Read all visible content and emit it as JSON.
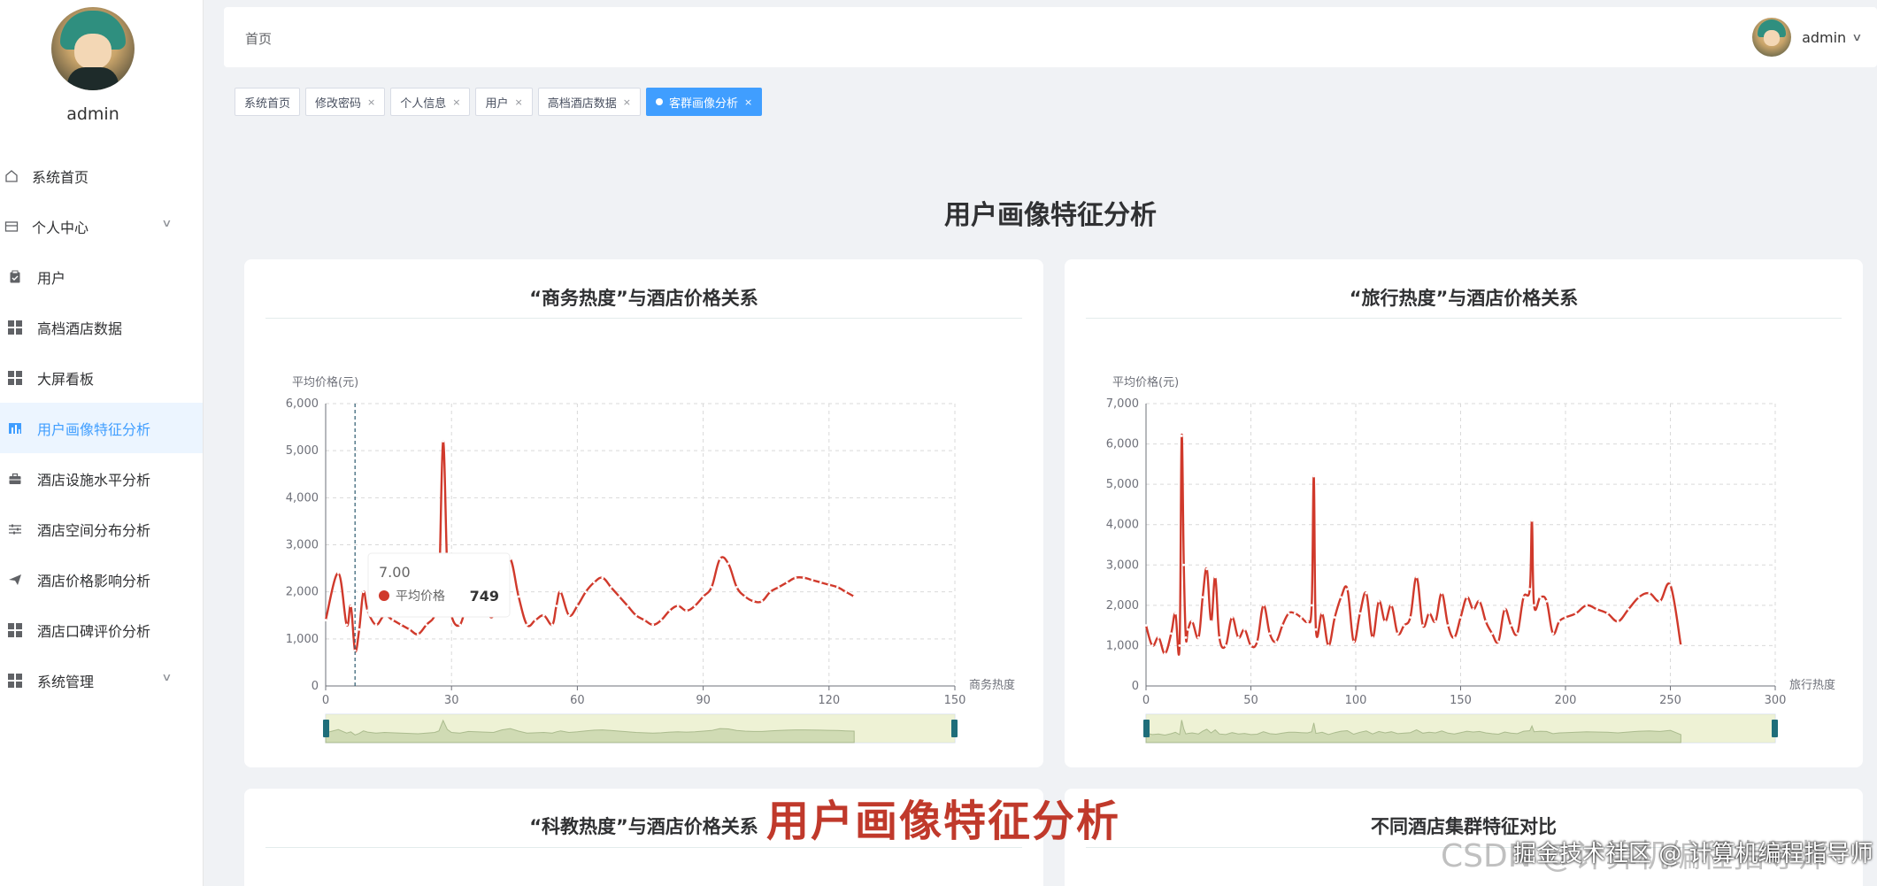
{
  "sidebar": {
    "username": "admin",
    "items": [
      {
        "label": "系统首页",
        "icon": "home-icon"
      },
      {
        "label": "个人中心",
        "icon": "id-card-icon",
        "expandable": true
      },
      {
        "label": "用户",
        "icon": "clipboard-icon"
      },
      {
        "label": "高档酒店数据",
        "icon": "grid-icon"
      },
      {
        "label": "大屏看板",
        "icon": "grid-icon"
      },
      {
        "label": "用户画像特征分析",
        "icon": "bar-chart-icon",
        "active": true
      },
      {
        "label": "酒店设施水平分析",
        "icon": "briefcase-icon"
      },
      {
        "label": "酒店空间分布分析",
        "icon": "sliders-icon"
      },
      {
        "label": "酒店价格影响分析",
        "icon": "send-icon"
      },
      {
        "label": "酒店口碑评价分析",
        "icon": "grid-icon"
      },
      {
        "label": "系统管理",
        "icon": "grid-icon",
        "expandable": true
      }
    ]
  },
  "header": {
    "breadcrumb": "首页",
    "user": "admin"
  },
  "tags": [
    {
      "label": "系统首页",
      "closable": false
    },
    {
      "label": "修改密码",
      "closable": true
    },
    {
      "label": "个人信息",
      "closable": true
    },
    {
      "label": "用户",
      "closable": true
    },
    {
      "label": "高档酒店数据",
      "closable": true
    },
    {
      "label": "客群画像分析",
      "closable": true,
      "active": true
    }
  ],
  "page_title": "用户画像特征分析",
  "cards": {
    "c1_title": "“商务热度”与酒店价格关系",
    "c2_title": "“旅行热度”与酒店价格关系",
    "c3_title": "“科教热度”与酒店价格关系",
    "c4_title": "不同酒店集群特征对比"
  },
  "overlay_title": "用户画像特征分析",
  "watermark": "CSDN @计算机编程指导师",
  "watermark2": "掘金技术社区 @ 计算机编程指导师",
  "chart_data": [
    {
      "type": "line",
      "title": "“商务热度”与酒店价格关系",
      "xlabel": "商务热度",
      "ylabel": "平均价格(元)",
      "xlim": [
        0,
        150
      ],
      "ylim": [
        0,
        6000
      ],
      "xticks": [
        0,
        30,
        60,
        90,
        120,
        150
      ],
      "yticks": [
        0,
        1000,
        2000,
        3000,
        4000,
        5000,
        6000
      ],
      "grid": true,
      "smooth": true,
      "color": "#d0392b",
      "series": [
        {
          "name": "平均价格",
          "x": [
            0,
            3,
            5,
            6,
            7,
            8,
            9,
            10,
            12,
            14,
            16,
            18,
            20,
            22,
            24,
            26,
            27,
            28,
            29,
            30,
            32,
            34,
            36,
            38,
            40,
            42,
            44,
            46,
            48,
            50,
            52,
            54,
            55,
            56,
            58,
            60,
            62,
            64,
            66,
            68,
            70,
            72,
            74,
            76,
            78,
            80,
            82,
            84,
            86,
            88,
            90,
            92,
            94,
            96,
            98,
            100,
            102,
            104,
            106,
            108,
            110,
            112,
            114,
            116,
            118,
            120,
            122,
            124,
            126
          ],
          "y": [
            1400,
            2400,
            1300,
            1700,
            749,
            1200,
            2000,
            1600,
            1300,
            1500,
            1400,
            1300,
            1200,
            1100,
            1300,
            1500,
            2000,
            5200,
            2400,
            1500,
            1300,
            1800,
            1700,
            1600,
            1500,
            2300,
            2700,
            1900,
            1300,
            1400,
            1500,
            1300,
            1700,
            2000,
            1500,
            1700,
            2000,
            2200,
            2300,
            2100,
            1900,
            1700,
            1500,
            1400,
            1300,
            1400,
            1600,
            1700,
            1600,
            1700,
            1900,
            2100,
            2700,
            2600,
            2100,
            1900,
            1800,
            1800,
            2000,
            2100,
            2200,
            2300,
            2300,
            2250,
            2200,
            2150,
            2100,
            2000,
            1900
          ]
        }
      ],
      "tooltip": {
        "x_label": "7.00",
        "series": "平均价格",
        "value": "749"
      },
      "crosshair_x": 7
    },
    {
      "type": "line",
      "title": "“旅行热度”与酒店价格关系",
      "xlabel": "旅行热度",
      "ylabel": "平均价格(元)",
      "xlim": [
        0,
        300
      ],
      "ylim": [
        0,
        7000
      ],
      "xticks": [
        0,
        50,
        100,
        150,
        200,
        250,
        300
      ],
      "yticks": [
        0,
        1000,
        2000,
        3000,
        4000,
        5000,
        6000,
        7000
      ],
      "grid": true,
      "smooth": true,
      "color": "#d0392b",
      "series": [
        {
          "name": "平均价格",
          "x": [
            0,
            3,
            6,
            9,
            12,
            14,
            16,
            17,
            18,
            19,
            20,
            22,
            25,
            27,
            29,
            31,
            33,
            35,
            38,
            41,
            44,
            47,
            50,
            53,
            56,
            59,
            62,
            65,
            68,
            71,
            74,
            77,
            79,
            80,
            81,
            84,
            87,
            90,
            93,
            96,
            99,
            102,
            105,
            108,
            111,
            114,
            117,
            120,
            123,
            126,
            129,
            132,
            135,
            138,
            141,
            144,
            147,
            150,
            153,
            156,
            159,
            162,
            165,
            168,
            171,
            174,
            177,
            180,
            183,
            184,
            185,
            188,
            191,
            194,
            197,
            200,
            205,
            210,
            215,
            220,
            225,
            230,
            235,
            240,
            245,
            250,
            255
          ],
          "y": [
            1500,
            1000,
            1200,
            800,
            1300,
            1800,
            1000,
            6200,
            3000,
            1200,
            1400,
            1600,
            1200,
            2200,
            2900,
            1600,
            2700,
            1200,
            1000,
            1700,
            1200,
            1400,
            1000,
            1100,
            2000,
            1300,
            1100,
            1500,
            1800,
            1800,
            1700,
            1600,
            2000,
            5200,
            1400,
            1800,
            1000,
            1700,
            2200,
            2400,
            1100,
            1800,
            2300,
            1200,
            2100,
            1600,
            2000,
            1300,
            1500,
            1700,
            2700,
            1500,
            1800,
            1600,
            2300,
            1500,
            1200,
            1700,
            2200,
            1900,
            2100,
            1600,
            1300,
            1100,
            1900,
            1500,
            1300,
            2200,
            2400,
            4100,
            2000,
            2200,
            2100,
            1300,
            1600,
            1700,
            1800,
            2000,
            1900,
            1800,
            1600,
            1900,
            2200,
            2300,
            2100,
            2500,
            1000
          ]
        }
      ]
    }
  ]
}
